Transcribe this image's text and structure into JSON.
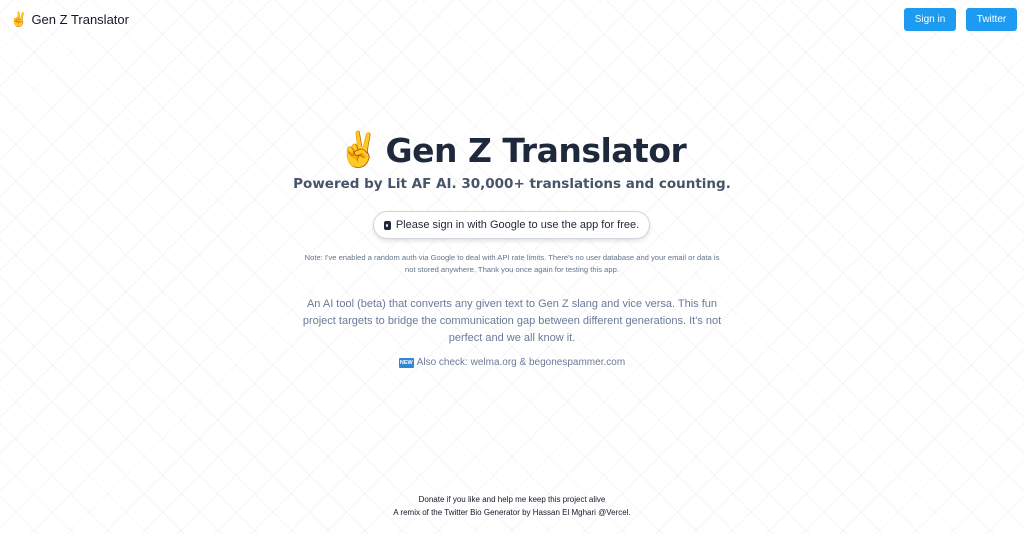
{
  "header": {
    "brand_emoji": "✌️",
    "brand_title": "Gen Z Translator",
    "signin_label": "Sign in",
    "twitter_label": "Twitter"
  },
  "hero": {
    "emoji": "✌️",
    "title": "Gen Z Translator",
    "subtitle": "Powered by Lit AF AI. 30,000+ translations and counting."
  },
  "signin_prompt": {
    "icon": "lock-icon",
    "label": "Please sign in with Google to use the app for free."
  },
  "note": "Note: I've enabled a random auth via Google to deal with API rate limits. There's no user database and your email or data is not stored anywhere. Thank you once again for testing this app.",
  "description": "An AI tool (beta) that converts any given text to Gen Z slang and vice versa. This fun project targets to bridge the communication gap between different generations. It's not perfect and we all know it.",
  "also_check": {
    "badge": "NEW",
    "prefix": "Also check: ",
    "link1": "welma.org",
    "separator": " & ",
    "link2": "begonespammer.com"
  },
  "footer": {
    "line1": "Donate if you like and help me keep this project alive",
    "line2": "A remix of the Twitter Bio Generator by Hassan El Mghari @Vercel."
  },
  "colors": {
    "accent": "#1d9bf0",
    "title": "#1e293b",
    "muted": "#6b7a99"
  }
}
